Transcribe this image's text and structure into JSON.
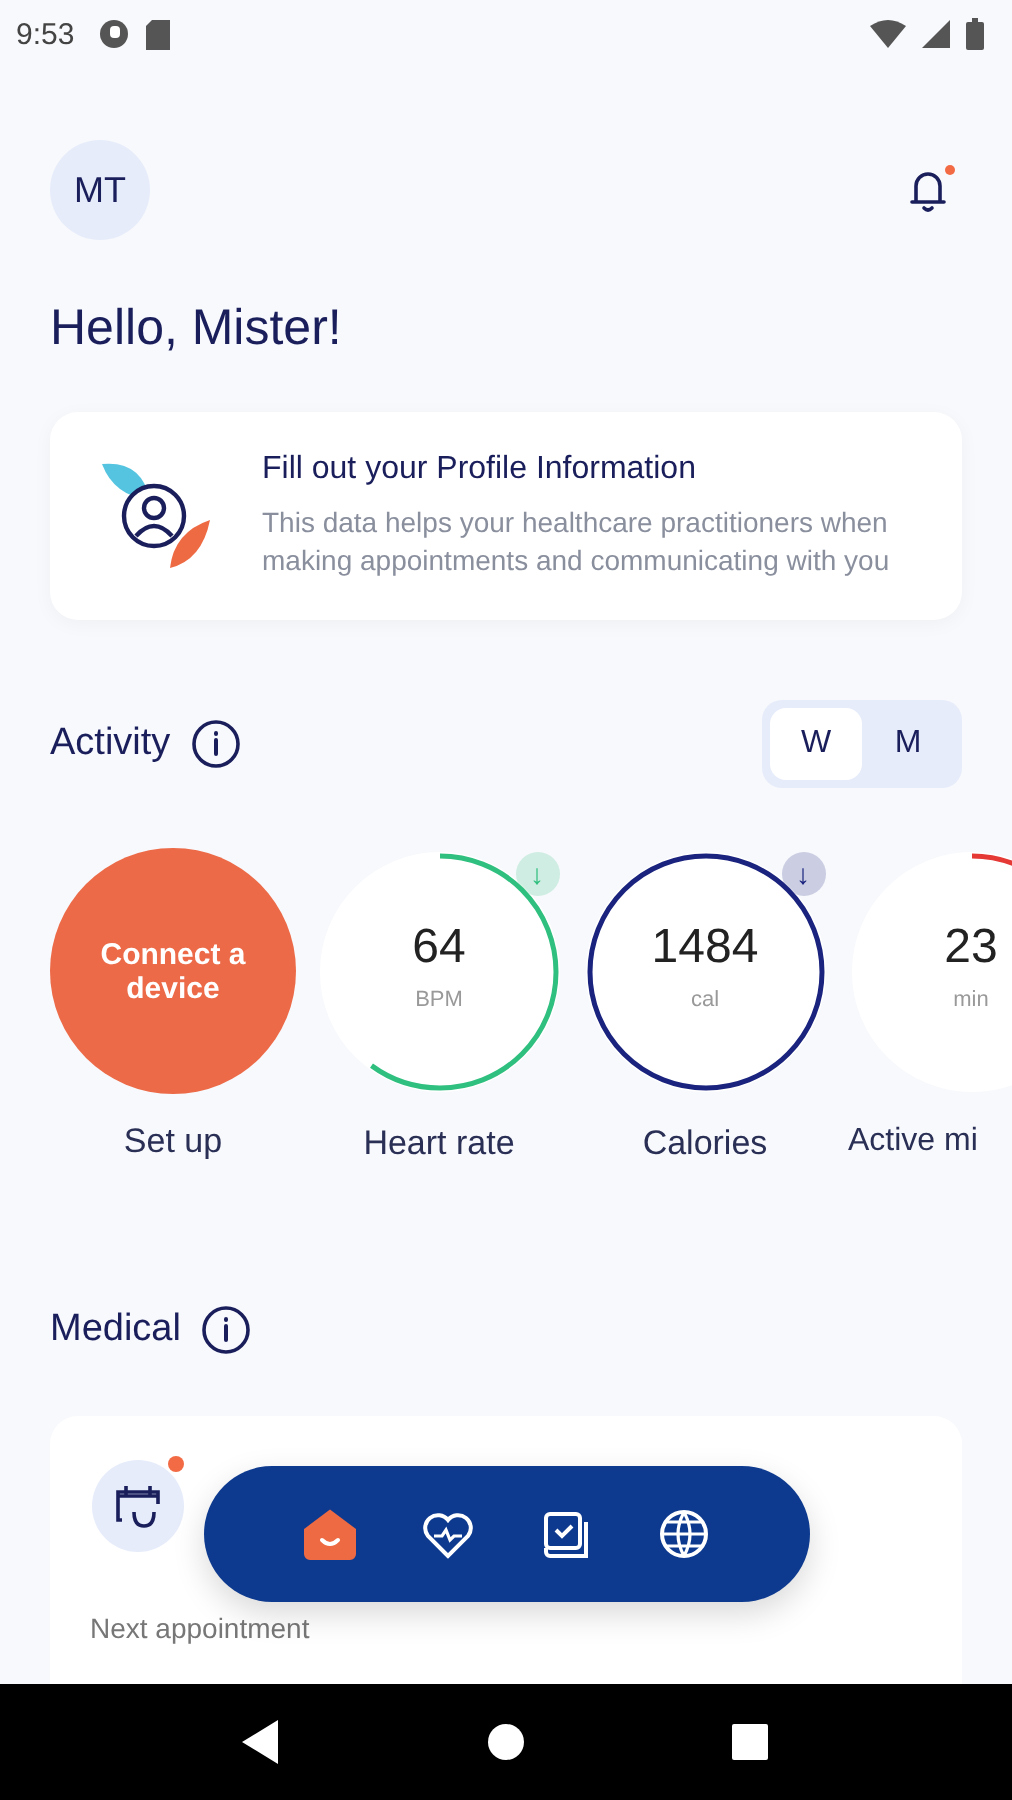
{
  "status_bar": {
    "time": "9:53"
  },
  "header": {
    "avatar_initials": "MT",
    "notification_unread": true
  },
  "greeting": "Hello, Mister!",
  "profile_card": {
    "title": "Fill out your Profile Information",
    "text": "This data helps your healthcare practitioners when making appointments and communicating with you"
  },
  "activity": {
    "title": "Activity",
    "period_tabs": [
      {
        "label": "W",
        "selected": true
      },
      {
        "label": "M",
        "selected": false
      }
    ],
    "metrics": [
      {
        "kind": "setup",
        "action": "Connect a device",
        "label": "Set up"
      },
      {
        "kind": "ring",
        "value": "64",
        "unit": "BPM",
        "label": "Heart rate",
        "color": "#2fbf7f",
        "badge": "↓"
      },
      {
        "kind": "ring",
        "value": "1484",
        "unit": "cal",
        "label": "Calories",
        "color": "#1a237e",
        "badge": "↓"
      },
      {
        "kind": "ring",
        "value": "23",
        "unit": "min",
        "label": "Active mi",
        "color": "#e53935"
      }
    ]
  },
  "medical": {
    "title": "Medical",
    "card": {
      "unread": true,
      "text": "Next appointment"
    }
  },
  "bottom_nav": [
    {
      "selected": true
    },
    {
      "selected": false
    },
    {
      "selected": false
    },
    {
      "selected": false
    }
  ]
}
